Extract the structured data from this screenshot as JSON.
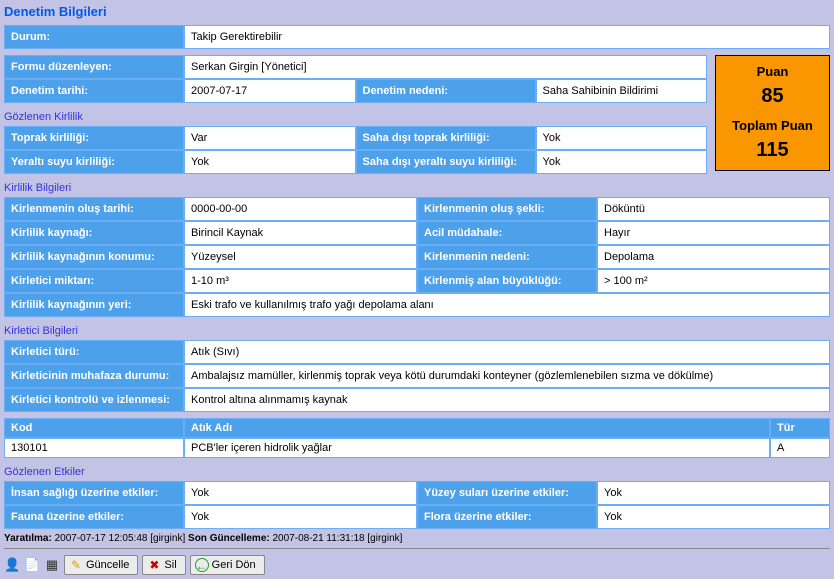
{
  "page_title": "Denetim Bilgileri",
  "durum": {
    "label": "Durum:",
    "value": "Takip Gerektirebilir"
  },
  "form_editor": {
    "label": "Formu düzenleyen:",
    "value": "Serkan Girgin [Yönetici]"
  },
  "inspection_date": {
    "label": "Denetim tarihi:",
    "value": "2007-07-17"
  },
  "inspection_reason": {
    "label": "Denetim nedeni:",
    "value": "Saha Sahibinin Bildirimi"
  },
  "score": {
    "label": "Puan",
    "value": "85",
    "total_label": "Toplam Puan",
    "total_value": "115"
  },
  "observed_pollution": {
    "title": "Gözlenen Kirlilik",
    "soil": {
      "label": "Toprak kirliliği:",
      "value": "Var"
    },
    "offsite_soil": {
      "label": "Saha dışı toprak kirliliği:",
      "value": "Yok"
    },
    "groundwater": {
      "label": "Yeraltı suyu kirliliği:",
      "value": "Yok"
    },
    "offsite_groundwater": {
      "label": "Saha dışı yeraltı suyu kirliliği:",
      "value": "Yok"
    }
  },
  "pollution_info": {
    "title": "Kirlilik Bilgileri",
    "occur_date": {
      "label": "Kirlenmenin oluş tarihi:",
      "value": "0000-00-00"
    },
    "occur_type": {
      "label": "Kirlenmenin oluş şekli:",
      "value": "Döküntü"
    },
    "source": {
      "label": "Kirlilik kaynağı:",
      "value": "Birincil Kaynak"
    },
    "emergency": {
      "label": "Acil müdahale:",
      "value": "Hayır"
    },
    "source_loc": {
      "label": "Kirlilik kaynağının konumu:",
      "value": "Yüzeysel"
    },
    "cause": {
      "label": "Kirlenmenin nedeni:",
      "value": "Depolama"
    },
    "amount": {
      "label": "Kirletici miktarı:",
      "value": "1-10 m³"
    },
    "area": {
      "label": "Kirlenmiş alan büyüklüğü:",
      "value": "> 100 m²"
    },
    "source_place": {
      "label": "Kirlilik kaynağının yeri:",
      "value": "Eski trafo ve kullanılmış trafo yağı depolama alanı"
    }
  },
  "pollutant_info": {
    "title": "Kirletici Bilgileri",
    "type": {
      "label": "Kirletici türü:",
      "value": "Atık (Sıvı)"
    },
    "storage": {
      "label": "Kirleticinin muhafaza durumu:",
      "value": "Ambalajsız mamüller, kirlenmiş toprak veya kötü durumdaki konteyner (gözlemlenebilen sızma ve dökülme)"
    },
    "control": {
      "label": "Kirletici kontrolü ve izlenmesi:",
      "value": "Kontrol altına alınmamış kaynak"
    },
    "table": {
      "head": {
        "code": "Kod",
        "name": "Atık Adı",
        "type": "Tür"
      },
      "rows": [
        {
          "code": "130101",
          "name": "PCB'ler içeren hidrolik yağlar",
          "type": "A"
        }
      ]
    }
  },
  "observed_effects": {
    "title": "Gözlenen Etkiler",
    "human": {
      "label": "İnsan sağlığı üzerine etkiler:",
      "value": "Yok"
    },
    "surface_water": {
      "label": "Yüzey suları üzerine etkiler:",
      "value": "Yok"
    },
    "fauna": {
      "label": "Fauna üzerine etkiler:",
      "value": "Yok"
    },
    "flora": {
      "label": "Flora üzerine etkiler:",
      "value": "Yok"
    }
  },
  "meta": {
    "created_label": "Yaratılma:",
    "created_value": "2007-07-17 12:05:48 [girgink]",
    "updated_label": "Son Güncelleme:",
    "updated_value": "2007-08-21 11:31:18 [girgink]"
  },
  "buttons": {
    "update": "Güncelle",
    "delete": "Sil",
    "back": "Geri Dön"
  }
}
